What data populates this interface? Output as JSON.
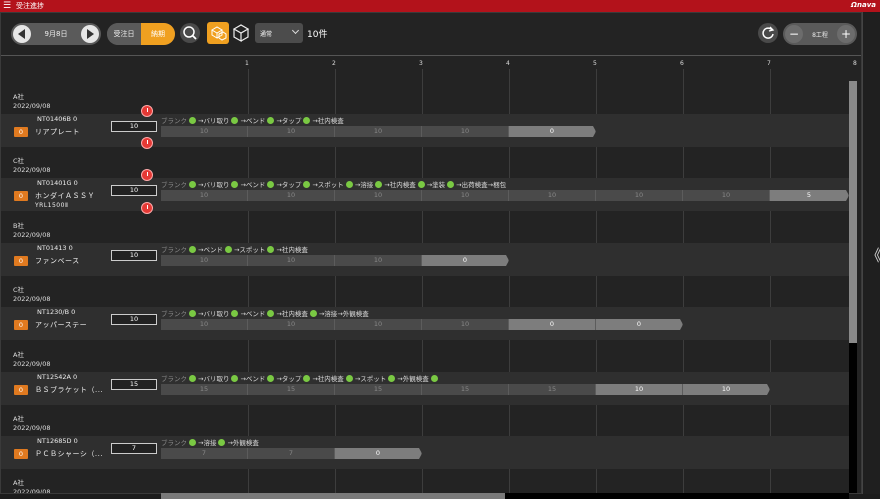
{
  "window": {
    "title": "受注進捗",
    "logo": "Ωnava"
  },
  "toolbar": {
    "date": "9月8日",
    "toggle_left": "受注日",
    "toggle_right": "納期",
    "mode_select": "通常",
    "count": "10件",
    "process_label": "8工程"
  },
  "axis": {
    "ticks": [
      "1",
      "2",
      "3",
      "4",
      "5",
      "6",
      "7",
      "8"
    ]
  },
  "groups": [
    {
      "company": "A社",
      "date": "2022/09/08",
      "order": "NT01406B 0",
      "badge": "0",
      "name": "リアプレート",
      "qty": "10",
      "steps": [
        {
          "t": "ブランク",
          "ok": true,
          "first": true
        },
        {
          "t": "→バリ取り",
          "ok": true
        },
        {
          "t": "→ベンド",
          "ok": true
        },
        {
          "t": "→タップ",
          "ok": true
        },
        {
          "t": "→社内検査",
          "ok": false
        }
      ],
      "bars": [
        "10",
        "10",
        "10",
        "10",
        "0"
      ]
    },
    {
      "company": "C社",
      "date": "2022/09/08",
      "order": "NT01401G 0",
      "badge": "0",
      "name": "ホンダイＡＳＳＹ",
      "name2": "YRL1500Ⅱ",
      "qty": "10",
      "steps": [
        {
          "t": "ブランク",
          "ok": true,
          "first": true
        },
        {
          "t": "→バリ取り",
          "ok": true
        },
        {
          "t": "→ベンド",
          "ok": true
        },
        {
          "t": "→タップ",
          "ok": true
        },
        {
          "t": "→スポット",
          "ok": true
        },
        {
          "t": "→溶接",
          "ok": true
        },
        {
          "t": "→社内検査",
          "ok": true
        },
        {
          "t": "→塗装",
          "ok": true
        },
        {
          "t": "→出荷検査",
          "ok": false
        },
        {
          "t": "→梱包",
          "ok": false
        }
      ],
      "bars": [
        "10",
        "10",
        "10",
        "10",
        "10",
        "10",
        "10",
        "5"
      ]
    },
    {
      "company": "B社",
      "date": "2022/09/08",
      "order": "NT01413 0",
      "badge": "0",
      "name": "ファンベース",
      "qty": "10",
      "steps": [
        {
          "t": "ブランク",
          "ok": true,
          "first": true
        },
        {
          "t": "→ベンド",
          "ok": true
        },
        {
          "t": "→スポット",
          "ok": true
        },
        {
          "t": "→社内検査",
          "ok": false
        }
      ],
      "bars": [
        "10",
        "10",
        "10",
        "0"
      ]
    },
    {
      "company": "C社",
      "date": "2022/09/08",
      "order": "NT1230/B 0",
      "badge": "0",
      "name": "アッパーステー",
      "qty": "10",
      "steps": [
        {
          "t": "ブランク",
          "ok": true,
          "first": true
        },
        {
          "t": "→バリ取り",
          "ok": true
        },
        {
          "t": "→ベンド",
          "ok": true
        },
        {
          "t": "→社内検査",
          "ok": true
        },
        {
          "t": "→溶接",
          "ok": false
        },
        {
          "t": "→外観検査",
          "ok": false
        }
      ],
      "bars": [
        "10",
        "10",
        "10",
        "10",
        "0",
        "0"
      ]
    },
    {
      "company": "A社",
      "date": "2022/09/08",
      "order": "NT12542A 0",
      "badge": "0",
      "name": "ＢＳブラケット（...",
      "qty": "15",
      "steps": [
        {
          "t": "ブランク",
          "ok": true,
          "first": true
        },
        {
          "t": "→バリ取り",
          "ok": true
        },
        {
          "t": "→ベンド",
          "ok": true
        },
        {
          "t": "→タップ",
          "ok": true
        },
        {
          "t": "→社内検査",
          "ok": true
        },
        {
          "t": "→スポット",
          "ok": true
        },
        {
          "t": "→外観検査",
          "ok": true
        }
      ],
      "bars": [
        "15",
        "15",
        "15",
        "15",
        "15",
        "10",
        "10"
      ]
    },
    {
      "company": "A社",
      "date": "2022/09/08",
      "order": "NT12685D 0",
      "badge": "0",
      "name": "ＰＣＢシャーシ（...",
      "qty": "7",
      "steps": [
        {
          "t": "ブランク",
          "ok": true,
          "first": true
        },
        {
          "t": "→溶接",
          "ok": true
        },
        {
          "t": "→外観検査",
          "ok": false
        }
      ],
      "bars": [
        "7",
        "7",
        "0"
      ]
    },
    {
      "company": "A社",
      "date": "2022/09/08"
    }
  ],
  "colors": {
    "titlebar": "#b3121b",
    "badge": "#e07a20",
    "check": "#7ac943",
    "alarm": "#e53935",
    "toggle_active": "#f0a020"
  }
}
